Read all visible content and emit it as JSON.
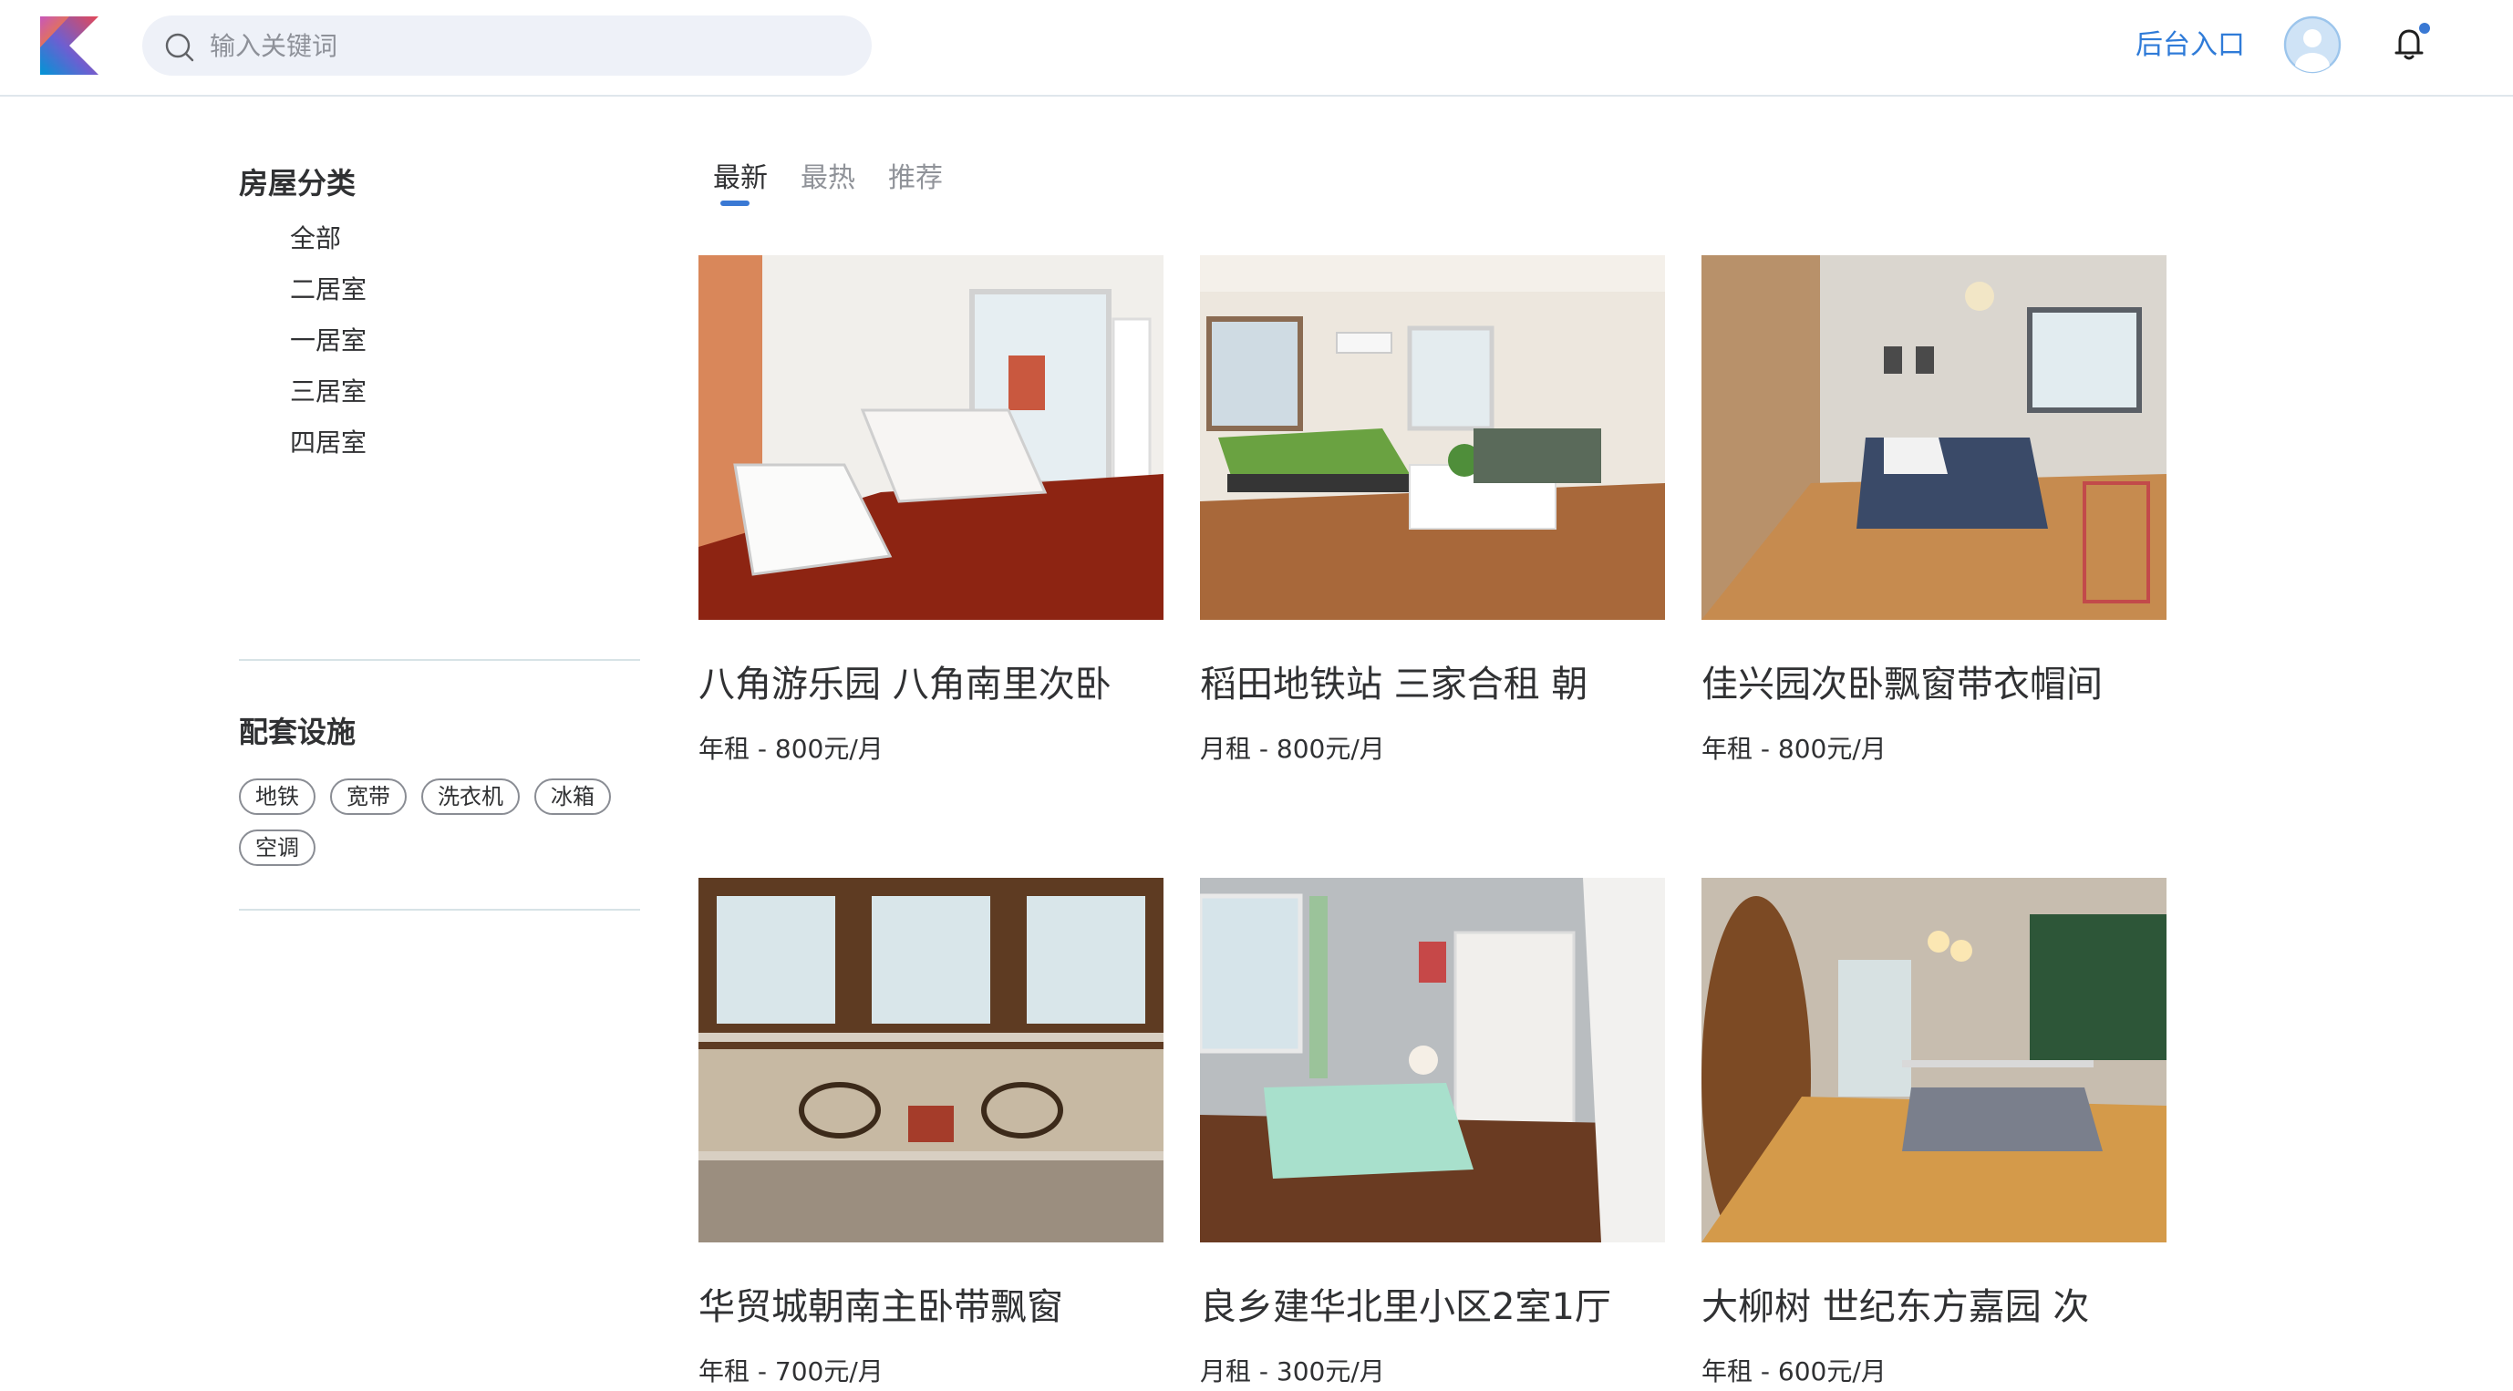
{
  "header": {
    "search_placeholder": "输入关键词",
    "admin_link": "后台入口",
    "notification_dot_color": "#3a79d4"
  },
  "sidebar": {
    "category_heading": "房屋分类",
    "categories": [
      "全部",
      "二居室",
      "一居室",
      "三居室",
      "四居室"
    ],
    "facilities_heading": "配套设施",
    "facilities": [
      "地铁",
      "宽带",
      "洗衣机",
      "冰箱",
      "空调"
    ]
  },
  "tabs": [
    {
      "label": "最新",
      "active": true
    },
    {
      "label": "最热",
      "active": false
    },
    {
      "label": "推荐",
      "active": false
    }
  ],
  "listings": [
    {
      "title": "八角游乐园 八角南里次卧",
      "price": "年租 - 800元/月"
    },
    {
      "title": "稻田地铁站 三家合租 朝",
      "price": "月租 - 800元/月"
    },
    {
      "title": "佳兴园次卧飘窗带衣帽间",
      "price": "年租 - 800元/月"
    },
    {
      "title": "华贸城朝南主卧带飘窗",
      "price": "年租 - 700元/月"
    },
    {
      "title": "良乡建华北里小区2室1厅",
      "price": "月租 - 300元/月"
    },
    {
      "title": "大柳树 世纪东方嘉园 次",
      "price": "年租 - 600元/月"
    }
  ],
  "colors": {
    "accent": "#2f7bd8",
    "tab_underline": "#3a79d4",
    "divider": "#d7e3e6"
  }
}
